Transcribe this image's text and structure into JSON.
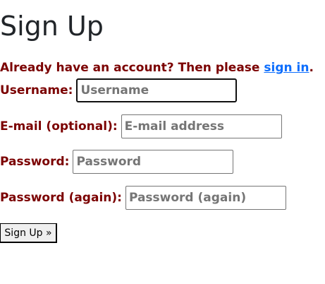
{
  "page": {
    "title": "Sign Up"
  },
  "signin_prompt": {
    "text": "Already have an account? Then please ",
    "link": "sign in",
    "end": "."
  },
  "form": {
    "username": {
      "label": "Username:",
      "placeholder": "Username"
    },
    "email": {
      "label": "E-mail (optional):",
      "placeholder": "E-mail address"
    },
    "password": {
      "label": "Password:",
      "placeholder": "Password"
    },
    "password_again": {
      "label": "Password (again):",
      "placeholder": "Password (again)"
    },
    "submit_label": "Sign Up »"
  },
  "colors": {
    "label": "#7b0000",
    "link": "#0d6efd",
    "title": "#212529"
  }
}
